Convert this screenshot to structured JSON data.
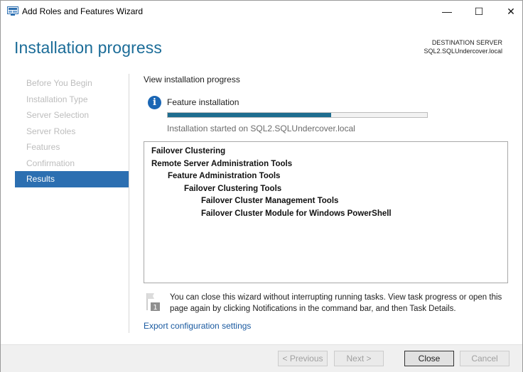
{
  "window": {
    "title": "Add Roles and Features Wizard",
    "controls": {
      "minimize": "—",
      "maximize": "☐",
      "close": "✕"
    }
  },
  "header": {
    "title": "Installation progress",
    "destination_label": "DESTINATION SERVER",
    "destination_server": "SQL2.SQLUndercover.local"
  },
  "sidebar": {
    "items": [
      {
        "label": "Before You Begin",
        "active": false
      },
      {
        "label": "Installation Type",
        "active": false
      },
      {
        "label": "Server Selection",
        "active": false
      },
      {
        "label": "Server Roles",
        "active": false
      },
      {
        "label": "Features",
        "active": false
      },
      {
        "label": "Confirmation",
        "active": false
      },
      {
        "label": "Results",
        "active": true
      }
    ]
  },
  "main": {
    "heading": "View installation progress",
    "feature_title": "Feature installation",
    "progress_fraction": 0.63,
    "status": "Installation started on SQL2.SQLUndercover.local",
    "features": [
      {
        "label": "Failover Clustering",
        "level": 0
      },
      {
        "label": "Remote Server Administration Tools",
        "level": 0
      },
      {
        "label": "Feature Administration Tools",
        "level": 1
      },
      {
        "label": "Failover Clustering Tools",
        "level": 2
      },
      {
        "label": "Failover Cluster Management Tools",
        "level": 3
      },
      {
        "label": "Failover Cluster Module for Windows PowerShell",
        "level": 3
      }
    ],
    "notice": "You can close this wizard without interrupting running tasks. View task progress or open this page again by clicking Notifications in the command bar, and then Task Details.",
    "notice_badge": "1",
    "export_link": "Export configuration settings"
  },
  "footer": {
    "previous": "< Previous",
    "next": "Next >",
    "close": "Close",
    "cancel": "Cancel"
  },
  "colors": {
    "accent": "#1b6c98",
    "nav_active": "#2c6fb1",
    "progress": "#1e6d8f",
    "link": "#1a5aa0"
  }
}
